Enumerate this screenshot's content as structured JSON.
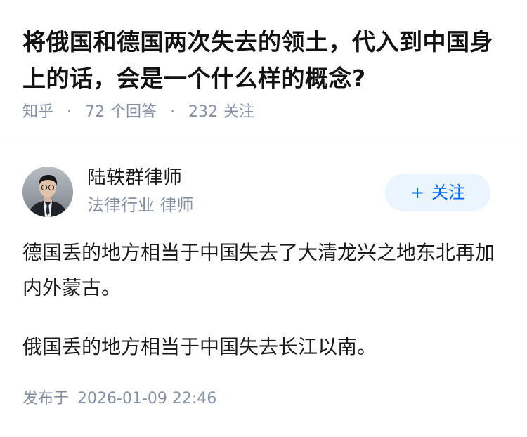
{
  "question": {
    "title": "将俄国和德国两次失去的领土，代入到中国身上的话，会是一个什么样的概念?",
    "source": "知乎",
    "answer_count": "72",
    "answer_label": "个回答",
    "follower_count": "232",
    "follower_label": "关注",
    "separator": "·"
  },
  "answer": {
    "author_name": "陆轶群律师",
    "author_tag": "法律行业 律师",
    "follow_plus": "+",
    "follow_label": "关注",
    "paragraphs": [
      "德国丢的地方相当于中国失去了大清龙兴之地东北再加内外蒙古。",
      "俄国丢的地方相当于中国失去长江以南。"
    ],
    "publish_label": "发布于",
    "publish_time": "2026-01-09 22:46"
  }
}
